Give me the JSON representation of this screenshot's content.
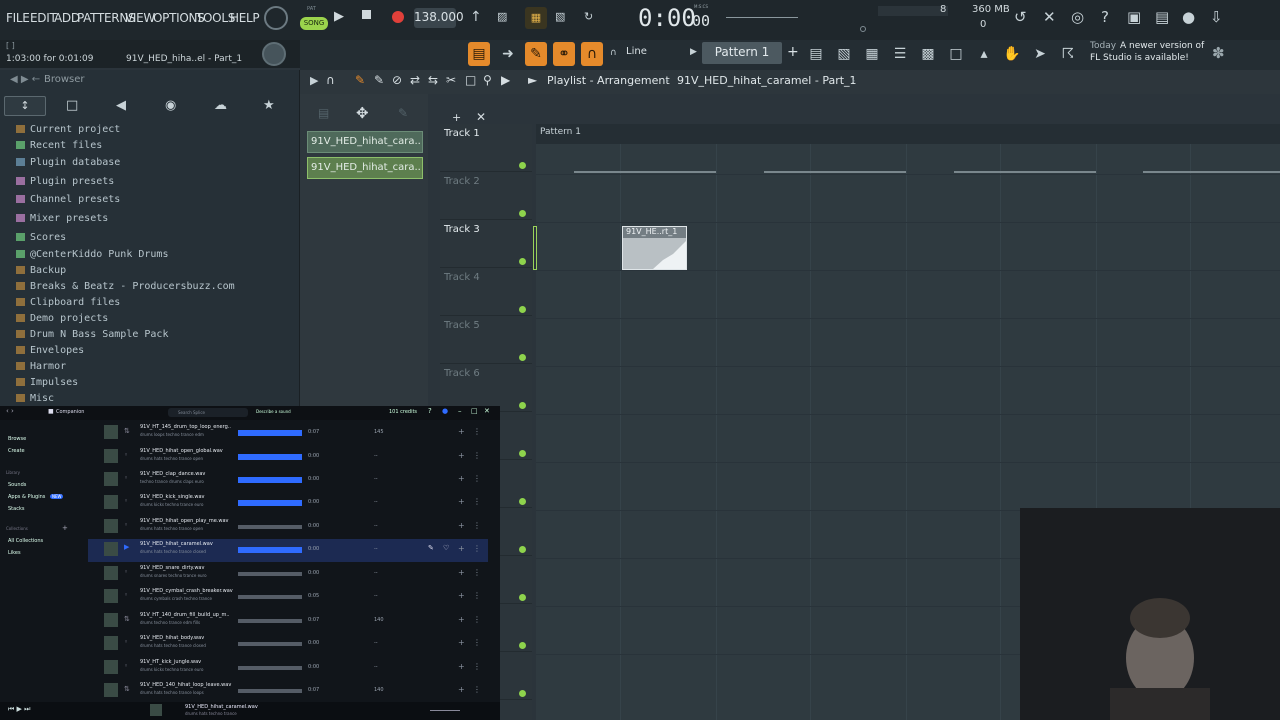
{
  "menu": [
    "FILE",
    "EDIT",
    "ADD",
    "PATTERNS",
    "VIEW",
    "OPTIONS",
    "TOOLS",
    "HELP"
  ],
  "transport": {
    "pat_label": "PAT",
    "song_label": "SONG",
    "tempo": "138.000",
    "time_main": "0:00",
    "time_sub": "00",
    "time_unit": "M:S:CS"
  },
  "counters": {
    "cpu": "8",
    "memory": "360 MB",
    "voices": "0"
  },
  "hint": {
    "top": "[ ]",
    "time_text": "1:03:00 for 0:01:09",
    "file": "91V_HED_hiha..el - Part_1"
  },
  "pattern_selector": "Pattern 1",
  "snap": "Line",
  "news": {
    "day": "Today",
    "line1": "A newer version of",
    "line2": "FL Studio is available!"
  },
  "browser": {
    "title": "Browser",
    "items": [
      "Current project",
      "Recent files",
      "Plugin database",
      "Plugin presets",
      "Channel presets",
      "Mixer presets",
      "Scores",
      "@CenterKiddo Punk Drums",
      "Backup",
      "Breaks & Beatz - Producersbuzz.com",
      "Clipboard files",
      "Demo projects",
      "Drum N Bass Sample Pack",
      "Envelopes",
      "Harmor",
      "Impulses",
      "Misc"
    ]
  },
  "playlist": {
    "title": "Playlist - Arrangement",
    "breadcrumb": "91V_HED_hihat_caramel - Part_1",
    "tracks": [
      "Track 1",
      "Track 2",
      "Track 3",
      "Track 4",
      "Track 5",
      "Track 6"
    ],
    "patterns": [
      "91V_HED_hihat_cara..",
      "91V_HED_hihat_cara.."
    ],
    "timeline_marker": "Pattern 1",
    "clip_label": "91V_HE..rt_1"
  },
  "companion": {
    "title": "Companion",
    "search_placeholder": "Search Splice",
    "describe": "Describe a sound",
    "credits": "101 credits",
    "nav": [
      "Browse",
      "Create"
    ],
    "library_label": "Library",
    "library": [
      "Sounds",
      "Apps & Plugins",
      "Stacks"
    ],
    "new_badge": "NEW",
    "collections_label": "Collections",
    "collections": [
      "All Collections",
      "Likes"
    ],
    "rows": [
      {
        "name": "91V_HT_145_drum_top_loop_energ..",
        "tags": "drums  loops  techno  trance  edm",
        "dur": "0:07",
        "bpm": "145"
      },
      {
        "name": "91V_HED_hihat_open_global.wav",
        "tags": "drums  hats  techno  trance  open",
        "dur": "0:00",
        "bpm": "--"
      },
      {
        "name": "91V_HED_clap_dance.wav",
        "tags": "techno  trance  drums  claps  euro",
        "dur": "0:00",
        "bpm": "--"
      },
      {
        "name": "91V_HED_kick_single.wav",
        "tags": "drums  kicks  techno  trance  euro",
        "dur": "0:00",
        "bpm": "--"
      },
      {
        "name": "91V_HED_hihat_open_play_me.wav",
        "tags": "drums  hats  techno  trance  open",
        "dur": "0:00",
        "bpm": "--"
      },
      {
        "name": "91V_HED_hihat_caramel.wav",
        "tags": "drums  hats  techno  trance  closed",
        "dur": "0:00",
        "bpm": "--"
      },
      {
        "name": "91V_HED_snare_dirty.wav",
        "tags": "drums  snares  techno  trance  euro",
        "dur": "0:00",
        "bpm": "--"
      },
      {
        "name": "91V_HED_cymbal_crash_breaker.wav",
        "tags": "drums  cymbals  crash  techno  trance",
        "dur": "0:05",
        "bpm": "--"
      },
      {
        "name": "91V_HT_140_drum_fill_build_up_m..",
        "tags": "drums  techno  trance  edm  fills",
        "dur": "0:07",
        "bpm": "140"
      },
      {
        "name": "91V_HED_hihat_body.wav",
        "tags": "drums  hats  techno  trance  closed",
        "dur": "0:00",
        "bpm": "--"
      },
      {
        "name": "91V_HT_kick_jungle.wav",
        "tags": "drums  kicks  techno  trance  euro",
        "dur": "0:00",
        "bpm": "--"
      },
      {
        "name": "91V_HED_140_hihat_loop_leave.wav",
        "tags": "drums  hats  techno  trance  loops",
        "dur": "0:07",
        "bpm": "140"
      }
    ],
    "player_name": "91V_HED_hihat_caramel.wav",
    "player_tags": "drums  hats  techno  trance"
  },
  "colors": {
    "accent_green": "#8ed34c",
    "accent_orange": "#e58a2b",
    "record_red": "#e0403a",
    "splice_blue": "#2f6bff"
  }
}
